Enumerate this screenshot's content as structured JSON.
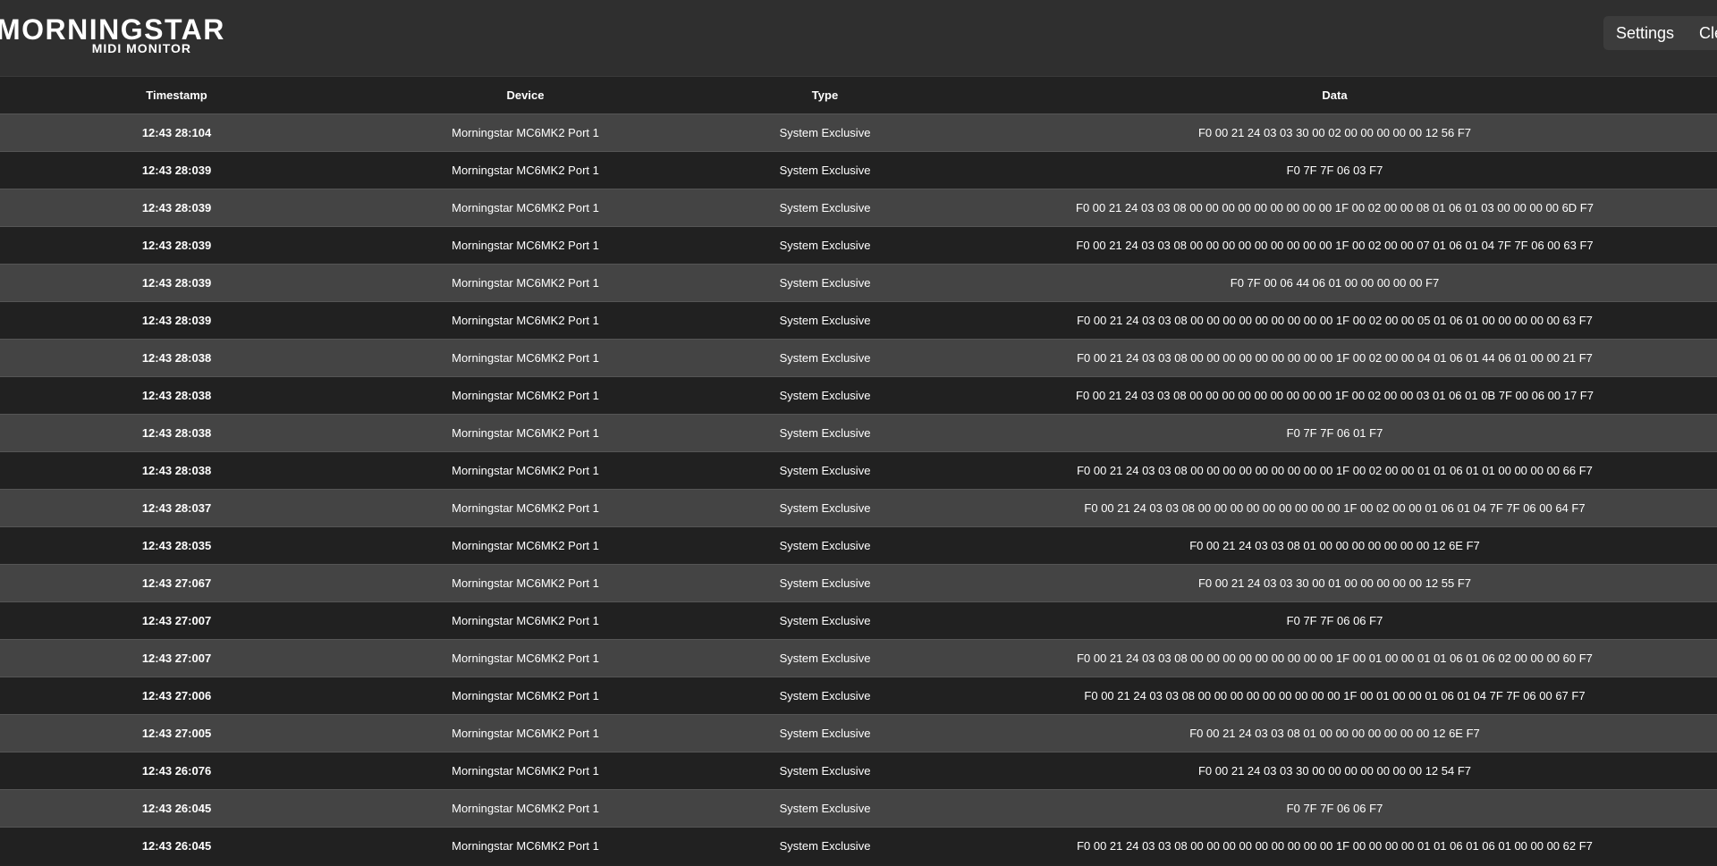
{
  "app": {
    "logo_main": "MORNINGSTAR",
    "logo_sub": "MIDI MONITOR"
  },
  "toolbar": {
    "settings_label": "Settings",
    "clear_label": "Clear"
  },
  "table": {
    "columns": [
      "Timestamp",
      "Device",
      "Type",
      "Data"
    ],
    "rows": [
      {
        "timestamp": "12:43 28:104",
        "device": "Morningstar MC6MK2 Port 1",
        "type": "System Exclusive",
        "data": "F0 00 21 24 03 03 30 00 02 00 00 00 00 00 12 56 F7"
      },
      {
        "timestamp": "12:43 28:039",
        "device": "Morningstar MC6MK2 Port 1",
        "type": "System Exclusive",
        "data": "F0 7F 7F 06 03 F7"
      },
      {
        "timestamp": "12:43 28:039",
        "device": "Morningstar MC6MK2 Port 1",
        "type": "System Exclusive",
        "data": "F0 00 21 24 03 03 08 00 00 00 00 00 00 00 00 00 1F 00 02 00 00 08 01 06 01 03 00 00 00 00 6D F7"
      },
      {
        "timestamp": "12:43 28:039",
        "device": "Morningstar MC6MK2 Port 1",
        "type": "System Exclusive",
        "data": "F0 00 21 24 03 03 08 00 00 00 00 00 00 00 00 00 1F 00 02 00 00 07 01 06 01 04 7F 7F 06 00 63 F7"
      },
      {
        "timestamp": "12:43 28:039",
        "device": "Morningstar MC6MK2 Port 1",
        "type": "System Exclusive",
        "data": "F0 7F 00 06 44 06 01 00 00 00 00 00 F7"
      },
      {
        "timestamp": "12:43 28:039",
        "device": "Morningstar MC6MK2 Port 1",
        "type": "System Exclusive",
        "data": "F0 00 21 24 03 03 08 00 00 00 00 00 00 00 00 00 1F 00 02 00 00 05 01 06 01 00 00 00 00 00 63 F7"
      },
      {
        "timestamp": "12:43 28:038",
        "device": "Morningstar MC6MK2 Port 1",
        "type": "System Exclusive",
        "data": "F0 00 21 24 03 03 08 00 00 00 00 00 00 00 00 00 1F 00 02 00 00 04 01 06 01 44 06 01 00 00 21 F7"
      },
      {
        "timestamp": "12:43 28:038",
        "device": "Morningstar MC6MK2 Port 1",
        "type": "System Exclusive",
        "data": "F0 00 21 24 03 03 08 00 00 00 00 00 00 00 00 00 1F 00 02 00 00 03 01 06 01 0B 7F 00 06 00 17 F7"
      },
      {
        "timestamp": "12:43 28:038",
        "device": "Morningstar MC6MK2 Port 1",
        "type": "System Exclusive",
        "data": "F0 7F 7F 06 01 F7"
      },
      {
        "timestamp": "12:43 28:038",
        "device": "Morningstar MC6MK2 Port 1",
        "type": "System Exclusive",
        "data": "F0 00 21 24 03 03 08 00 00 00 00 00 00 00 00 00 1F 00 02 00 00 01 01 06 01 01 00 00 00 00 66 F7"
      },
      {
        "timestamp": "12:43 28:037",
        "device": "Morningstar MC6MK2 Port 1",
        "type": "System Exclusive",
        "data": "F0 00 21 24 03 03 08 00 00 00 00 00 00 00 00 00 1F 00 02 00 00 01 06 01 04 7F 7F 06 00 64 F7"
      },
      {
        "timestamp": "12:43 28:035",
        "device": "Morningstar MC6MK2 Port 1",
        "type": "System Exclusive",
        "data": "F0 00 21 24 03 03 08 01 00 00 00 00 00 00 00 12 6E F7"
      },
      {
        "timestamp": "12:43 27:067",
        "device": "Morningstar MC6MK2 Port 1",
        "type": "System Exclusive",
        "data": "F0 00 21 24 03 03 30 00 01 00 00 00 00 00 12 55 F7"
      },
      {
        "timestamp": "12:43 27:007",
        "device": "Morningstar MC6MK2 Port 1",
        "type": "System Exclusive",
        "data": "F0 7F 7F 06 06 F7"
      },
      {
        "timestamp": "12:43 27:007",
        "device": "Morningstar MC6MK2 Port 1",
        "type": "System Exclusive",
        "data": "F0 00 21 24 03 03 08 00 00 00 00 00 00 00 00 00 1F 00 01 00 00 01 01 06 01 06 02 00 00 00 60 F7"
      },
      {
        "timestamp": "12:43 27:006",
        "device": "Morningstar MC6MK2 Port 1",
        "type": "System Exclusive",
        "data": "F0 00 21 24 03 03 08 00 00 00 00 00 00 00 00 00 1F 00 01 00 00 01 06 01 04 7F 7F 06 00 67 F7"
      },
      {
        "timestamp": "12:43 27:005",
        "device": "Morningstar MC6MK2 Port 1",
        "type": "System Exclusive",
        "data": "F0 00 21 24 03 03 08 01 00 00 00 00 00 00 00 12 6E F7"
      },
      {
        "timestamp": "12:43 26:076",
        "device": "Morningstar MC6MK2 Port 1",
        "type": "System Exclusive",
        "data": "F0 00 21 24 03 03 30 00 00 00 00 00 00 00 12 54 F7"
      },
      {
        "timestamp": "12:43 26:045",
        "device": "Morningstar MC6MK2 Port 1",
        "type": "System Exclusive",
        "data": "F0 7F 7F 06 06 F7"
      },
      {
        "timestamp": "12:43 26:045",
        "device": "Morningstar MC6MK2 Port 1",
        "type": "System Exclusive",
        "data": "F0 00 21 24 03 03 08 00 00 00 00 00 00 00 00 00 1F 00 00 00 00 01 01 06 01 06 01 00 00 00 62 F7"
      }
    ]
  }
}
